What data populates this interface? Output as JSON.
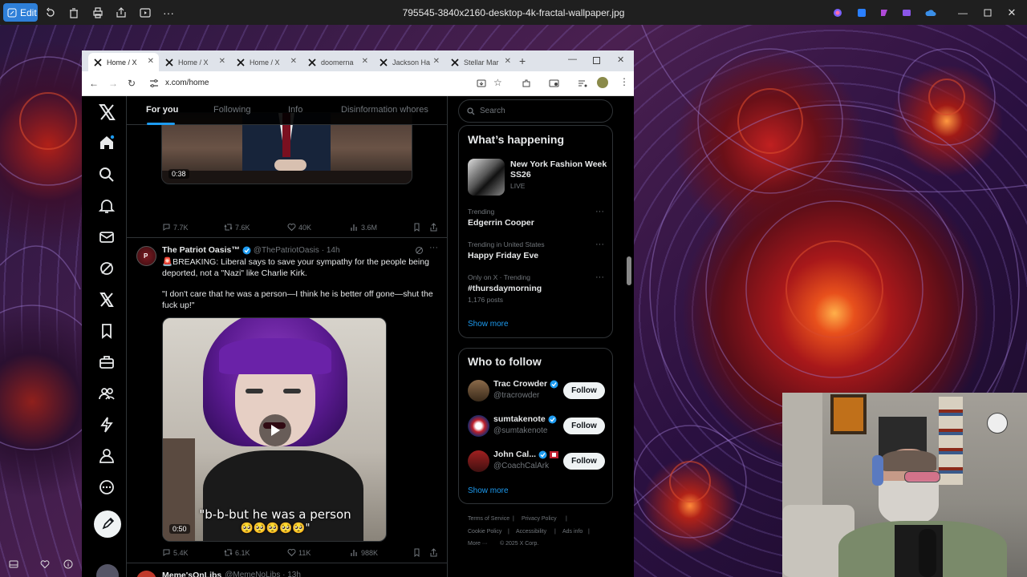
{
  "viewer": {
    "edit_label": "Edit",
    "file_name": "795545-3840x2160-desktop-4k-fractal-wallpaper.jpg"
  },
  "browser": {
    "tabs": [
      {
        "label": "Home / X",
        "active": true
      },
      {
        "label": "Home / X"
      },
      {
        "label": "Home / X"
      },
      {
        "label": "doomerna"
      },
      {
        "label": "Jackson Ha"
      },
      {
        "label": "Stellar Mar"
      }
    ],
    "url": "x.com/home"
  },
  "x": {
    "top_tabs": [
      "For you",
      "Following",
      "Info",
      "Disinformation whores"
    ],
    "post1": {
      "duration": "0:38",
      "replies": "7.7K",
      "reposts": "7.6K",
      "likes": "40K",
      "views": "3.6M"
    },
    "post2": {
      "name": "The Patriot Oasis™",
      "handle": "@ThePatriotOasis",
      "time": "· 14h",
      "text1": "🚨BREAKING: Liberal says to save your sympathy for the people being deported, not a \"Nazi\" like Charlie Kirk.",
      "text2": "\"I don't care that he was a person—I think he is better off gone—shut the fuck up!\"",
      "caption1": "\"b-b-but he was a person",
      "caption2": "🥺🥺🥺🥺🥺\"",
      "duration": "0:50",
      "replies": "5.4K",
      "reposts": "6.1K",
      "likes": "11K",
      "views": "988K"
    },
    "post3": {
      "name": "Meme'sOnLibs",
      "handle": "@MemeNoLibs · 13h"
    },
    "search_placeholder": "Search",
    "happening": {
      "title": "What’s happening",
      "event": {
        "title": "New York Fashion Week SS26",
        "status": "LIVE"
      },
      "trends": [
        {
          "context": "Trending",
          "name": "Edgerrin Cooper"
        },
        {
          "context": "Trending in United States",
          "name": "Happy Friday Eve"
        },
        {
          "context": "Only on X · Trending",
          "name": "#thursdaymorning",
          "count": "1,176 posts"
        }
      ],
      "show_more": "Show more"
    },
    "follow": {
      "title": "Who to follow",
      "people": [
        {
          "name": "Trac Crowder",
          "handle": "@tracrowder",
          "button": "Follow"
        },
        {
          "name": "sumtakenote",
          "handle": "@sumtakenote",
          "button": "Follow"
        },
        {
          "name": "John Cal...",
          "handle": "@CoachCalArk",
          "button": "Follow"
        }
      ],
      "show_more": "Show more"
    },
    "footer": {
      "l1": "Terms of Service",
      "l2": "Privacy Policy",
      "l3": "Cookie Policy",
      "l4": "Accessibility",
      "l5": "Ads info",
      "l6": "More ···",
      "copy": "© 2025 X Corp."
    }
  },
  "colors": {
    "x_blue": "#1d9bf0",
    "edit_blue": "#2e7fd8"
  }
}
